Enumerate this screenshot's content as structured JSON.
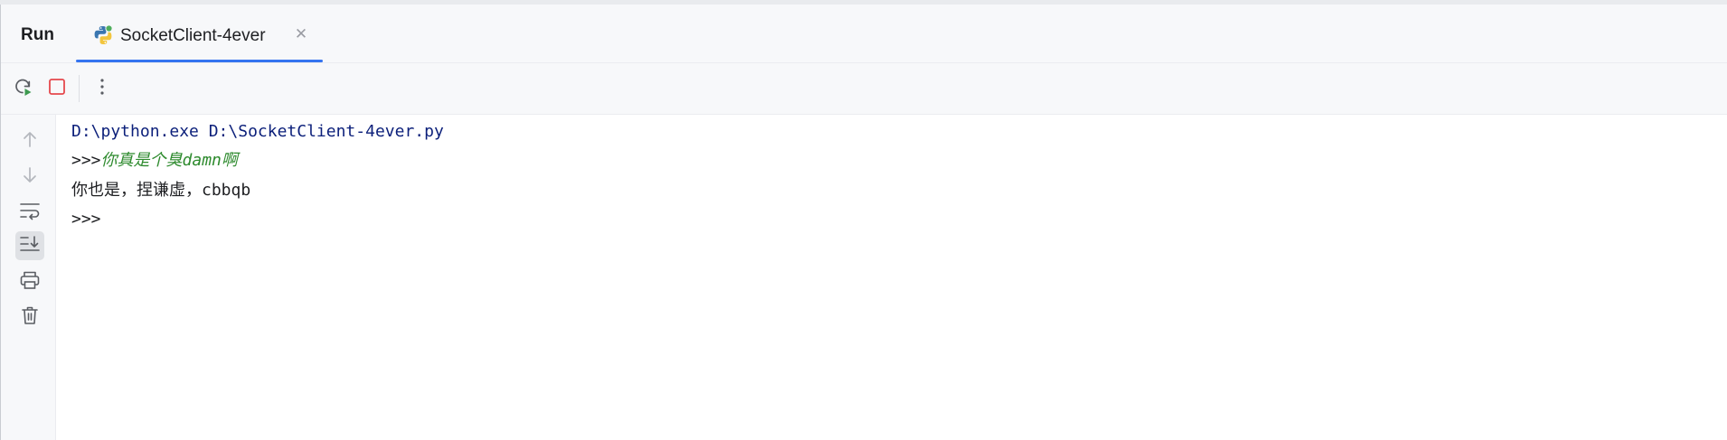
{
  "window": {
    "title": "Run"
  },
  "tabs": [
    {
      "label": "SocketClient-4ever",
      "icon": "python-icon",
      "active": true
    }
  ],
  "toolbar": {
    "buttons": [
      {
        "name": "rerun-button",
        "icon": "rerun-icon"
      },
      {
        "name": "stop-button",
        "icon": "stop-icon"
      },
      {
        "name": "more-options-button",
        "icon": "vertical-ellipsis-icon"
      }
    ]
  },
  "sidebar": {
    "buttons": [
      {
        "name": "scroll-up-button",
        "icon": "arrow-up-icon"
      },
      {
        "name": "scroll-down-button",
        "icon": "arrow-down-icon"
      },
      {
        "name": "soft-wrap-button",
        "icon": "soft-wrap-icon"
      },
      {
        "name": "scroll-to-end-button",
        "icon": "scroll-to-end-icon",
        "active": true
      },
      {
        "name": "print-button",
        "icon": "printer-icon"
      },
      {
        "name": "clear-all-button",
        "icon": "trash-icon"
      }
    ]
  },
  "console": {
    "command": "D:\\python.exe D:\\SocketClient-4ever.py",
    "prompt1": ">>>",
    "input1": "你真是个臭damn啊",
    "output1": "你也是，捏谦虚，cbbqb",
    "prompt2": ">>>"
  },
  "colors": {
    "accent": "#3574f0",
    "stop": "#e5484d",
    "rerun": "#3d9a50",
    "command_text": "#0b1f7a",
    "user_input_text": "#2d8a2d"
  }
}
